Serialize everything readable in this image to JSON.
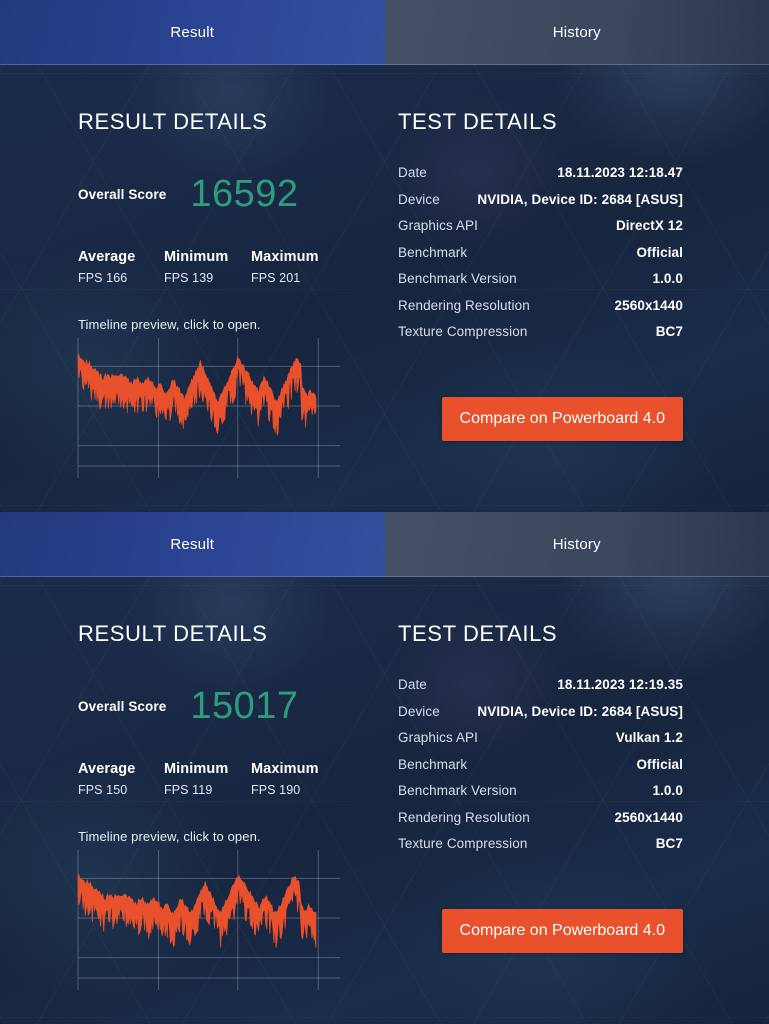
{
  "panels": [
    {
      "tabs": [
        {
          "label": "Result",
          "active": true
        },
        {
          "label": "History",
          "active": false
        }
      ],
      "result": {
        "title": "RESULT DETAILS",
        "score_label": "Overall Score",
        "score_value": "16592",
        "stats": [
          {
            "head": "Average",
            "value": "FPS 166"
          },
          {
            "head": "Minimum",
            "value": "FPS 139"
          },
          {
            "head": "Maximum",
            "value": "FPS 201"
          }
        ],
        "timeline_caption": "Timeline preview, click to open."
      },
      "test": {
        "title": "TEST DETAILS",
        "rows": [
          {
            "key": "Date",
            "value": "18.11.2023 12:18.47"
          },
          {
            "key": "Device",
            "value": "NVIDIA, Device ID: 2684 [ASUS]"
          },
          {
            "key": "Graphics API",
            "value": "DirectX 12"
          },
          {
            "key": "Benchmark",
            "value": "Official"
          },
          {
            "key": "Benchmark Version",
            "value": "1.0.0"
          },
          {
            "key": "Rendering Resolution",
            "value": "2560x1440"
          },
          {
            "key": "Texture Compression",
            "value": "BC7"
          }
        ],
        "compare_label": "Compare on Powerboard 4.0"
      },
      "chart_data": {
        "type": "line",
        "title": "Timeline preview",
        "xlabel": "",
        "ylabel": "FPS",
        "grid": true,
        "legend": false,
        "ylim": [
          0,
          220
        ],
        "avg": 166,
        "min": 139,
        "max": 201,
        "color": "#e8512c",
        "values": [
          205,
          201,
          198,
          203,
          199,
          195,
          197,
          192,
          190,
          193,
          188,
          186,
          189,
          184,
          181,
          183,
          179,
          176,
          178,
          174,
          171,
          173,
          169,
          166,
          168,
          164,
          161,
          163,
          166,
          170,
          168,
          165,
          167,
          169,
          166,
          164,
          167,
          165,
          163,
          166,
          168,
          165,
          163,
          166,
          168,
          171,
          169,
          166,
          164,
          167,
          165,
          162,
          160,
          158,
          156,
          154,
          152,
          150,
          155,
          160,
          158,
          156,
          159,
          161,
          158,
          156,
          154,
          152,
          150,
          148,
          152,
          156,
          160,
          164,
          166,
          163,
          160,
          157,
          154,
          151,
          148,
          145,
          142,
          140,
          144,
          148,
          152,
          150,
          147,
          144,
          141,
          138,
          135,
          132,
          136,
          140,
          144,
          148,
          152,
          156,
          160,
          158,
          155,
          152,
          149,
          146,
          143,
          140,
          137,
          134,
          131,
          128,
          125,
          128,
          132,
          136,
          140,
          144,
          148,
          152,
          156,
          160,
          164,
          168,
          172,
          176,
          180,
          184,
          188,
          192,
          188,
          184,
          180,
          176,
          172,
          168,
          164,
          160,
          156,
          152,
          148,
          144,
          140,
          136,
          132,
          128,
          124,
          120,
          118,
          122,
          126,
          130,
          134,
          138,
          142,
          146,
          150,
          154,
          158,
          162,
          166,
          170,
          174,
          178,
          182,
          186,
          190,
          194,
          198,
          201,
          198,
          195,
          192,
          189,
          186,
          183,
          180,
          177,
          174,
          171,
          168,
          165,
          162,
          159,
          156,
          153,
          150,
          147,
          144,
          141,
          138,
          142,
          146,
          150,
          154,
          158,
          162,
          166,
          162,
          158,
          154,
          150,
          146,
          142,
          138,
          134,
          130,
          126,
          122,
          118,
          120,
          124,
          128,
          132,
          136,
          140,
          144,
          148,
          152,
          156,
          160,
          164,
          168,
          172,
          176,
          180,
          184,
          188,
          192,
          196,
          200,
          198,
          196,
          194,
          192,
          190,
          150,
          146,
          142,
          138,
          134,
          130,
          128,
          132,
          136,
          140,
          138,
          136,
          134,
          132,
          130,
          128
        ]
      }
    },
    {
      "tabs": [
        {
          "label": "Result",
          "active": true
        },
        {
          "label": "History",
          "active": false
        }
      ],
      "result": {
        "title": "RESULT DETAILS",
        "score_label": "Overall Score",
        "score_value": "15017",
        "stats": [
          {
            "head": "Average",
            "value": "FPS 150"
          },
          {
            "head": "Minimum",
            "value": "FPS 119"
          },
          {
            "head": "Maximum",
            "value": "FPS 190"
          }
        ],
        "timeline_caption": "Timeline preview, click to open."
      },
      "test": {
        "title": "TEST DETAILS",
        "rows": [
          {
            "key": "Date",
            "value": "18.11.2023 12:19.35"
          },
          {
            "key": "Device",
            "value": "NVIDIA, Device ID: 2684 [ASUS]"
          },
          {
            "key": "Graphics API",
            "value": "Vulkan 1.2"
          },
          {
            "key": "Benchmark",
            "value": "Official"
          },
          {
            "key": "Benchmark Version",
            "value": "1.0.0"
          },
          {
            "key": "Rendering Resolution",
            "value": "2560x1440"
          },
          {
            "key": "Texture Compression",
            "value": "BC7"
          }
        ],
        "compare_label": "Compare on Powerboard 4.0"
      },
      "chart_data": {
        "type": "line",
        "title": "Timeline preview",
        "xlabel": "",
        "ylabel": "FPS",
        "grid": true,
        "legend": false,
        "ylim": [
          0,
          220
        ],
        "avg": 150,
        "min": 119,
        "max": 190,
        "color": "#e8512c",
        "values": [
          190,
          186,
          183,
          187,
          184,
          180,
          182,
          178,
          175,
          178,
          174,
          171,
          173,
          169,
          166,
          168,
          164,
          161,
          163,
          159,
          156,
          158,
          154,
          151,
          153,
          149,
          146,
          148,
          151,
          155,
          153,
          150,
          152,
          154,
          151,
          149,
          152,
          150,
          148,
          151,
          153,
          150,
          148,
          151,
          153,
          156,
          154,
          151,
          149,
          152,
          150,
          147,
          145,
          143,
          141,
          139,
          137,
          135,
          140,
          145,
          143,
          141,
          144,
          146,
          143,
          141,
          139,
          137,
          135,
          133,
          137,
          141,
          145,
          149,
          151,
          148,
          145,
          142,
          139,
          136,
          133,
          130,
          127,
          125,
          129,
          133,
          137,
          135,
          132,
          129,
          126,
          123,
          121,
          119,
          123,
          127,
          131,
          135,
          139,
          143,
          147,
          145,
          142,
          139,
          136,
          133,
          130,
          127,
          124,
          122,
          120,
          123,
          127,
          131,
          135,
          139,
          143,
          147,
          151,
          155,
          159,
          163,
          167,
          171,
          175,
          172,
          168,
          164,
          160,
          156,
          152,
          148,
          144,
          140,
          136,
          132,
          128,
          124,
          122,
          120,
          124,
          128,
          132,
          136,
          140,
          144,
          148,
          152,
          156,
          160,
          164,
          168,
          172,
          176,
          180,
          184,
          188,
          190,
          187,
          184,
          181,
          178,
          175,
          172,
          169,
          166,
          163,
          160,
          157,
          154,
          151,
          148,
          145,
          142,
          139,
          136,
          133,
          130,
          134,
          138,
          142,
          146,
          150,
          154,
          151,
          147,
          143,
          139,
          135,
          131,
          127,
          123,
          121,
          119,
          122,
          126,
          130,
          134,
          138,
          142,
          146,
          150,
          154,
          158,
          162,
          166,
          170,
          174,
          178,
          182,
          186,
          188,
          185,
          182,
          179,
          176,
          173,
          140,
          136,
          132,
          128,
          125,
          122,
          126,
          130,
          134,
          132,
          130,
          128,
          126,
          124,
          122,
          120
        ]
      }
    }
  ]
}
